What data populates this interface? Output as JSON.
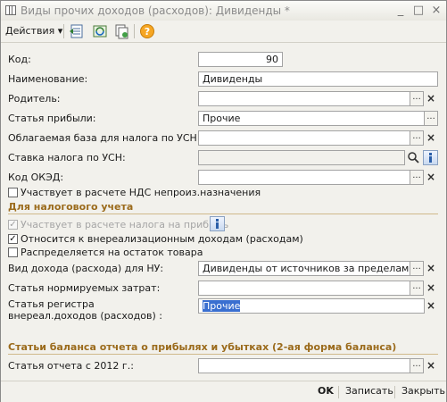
{
  "window": {
    "title": "Виды прочих доходов (расходов): Дивиденды *",
    "minimize_glyph": "_",
    "maximize_glyph": "□",
    "close_glyph": "×"
  },
  "toolbar": {
    "actions_label": "Действия",
    "actions_arrow": "▾",
    "icons": [
      "list-icon",
      "refresh-icon",
      "copy-icon",
      "help-icon"
    ]
  },
  "form": {
    "kod": {
      "label": "Код:",
      "value": "90"
    },
    "name": {
      "label": "Наименование:",
      "value": "Дивиденды"
    },
    "parent": {
      "label": "Родитель:",
      "value": ""
    },
    "profit_item": {
      "label": "Статья прибыли:",
      "value": "Прочие"
    },
    "usn_base": {
      "label": "Облагаемая база для налога по УСН:",
      "value": ""
    },
    "usn_rate": {
      "label": "Ставка налога по УСН:",
      "value": ""
    },
    "okved": {
      "label": "Код ОКЭД:",
      "value": ""
    },
    "vat_nonprod": {
      "label": "Участвует в расчете НДС непроиз.назначения",
      "checked": false
    }
  },
  "tax_section": {
    "header": "Для налогового учета",
    "participates_profit_tax": {
      "label": "Участвует в расчете налога на прибыль",
      "checked": true,
      "disabled": true
    },
    "non_operating": {
      "label": "Относится к внереализационным доходам (расходам)",
      "checked": true
    },
    "distributed_to_goods": {
      "label": "Распределяется на остаток товара",
      "checked": false
    },
    "income_kind": {
      "label": "Вид дохода (расхода) для НУ:",
      "value": "Дивиденды от источников за пределами РБ"
    },
    "normalized_costs": {
      "label": "Статья нормируемых затрат:",
      "value": ""
    },
    "register_item": {
      "label": "Статья регистра внереал.доходов (расходов) :",
      "value": "Прочие"
    }
  },
  "balance_section": {
    "header": "Статьи баланса отчета о прибылях и убытках (2-ая форма баланса)",
    "report_item_2012": {
      "label": "Статья отчета с 2012 г.:",
      "value": ""
    }
  },
  "footer": {
    "ok": "OK",
    "save": "Записать",
    "close": "Закрыть"
  },
  "buttons": {
    "select_glyph": "...",
    "clear_glyph": "×",
    "check_glyph": "✓"
  },
  "colors": {
    "section_header": "#9b6b1c",
    "selection": "#3a6fd0",
    "disabled_text": "#a5a5a5"
  }
}
